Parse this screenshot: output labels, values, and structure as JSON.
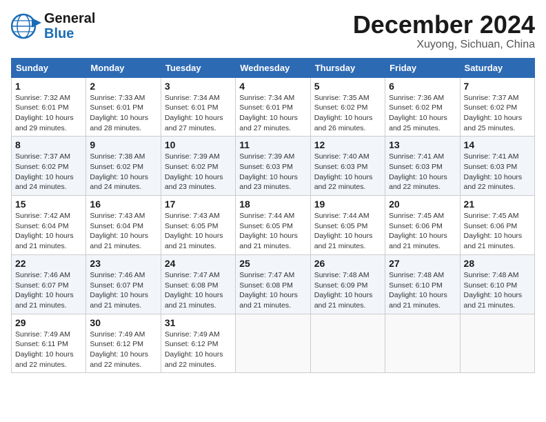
{
  "header": {
    "logo_line1": "General",
    "logo_line2": "Blue",
    "month": "December 2024",
    "location": "Xuyong, Sichuan, China"
  },
  "weekdays": [
    "Sunday",
    "Monday",
    "Tuesday",
    "Wednesday",
    "Thursday",
    "Friday",
    "Saturday"
  ],
  "weeks": [
    [
      {
        "day": "1",
        "sunrise": "7:32 AM",
        "sunset": "6:01 PM",
        "daylight": "10 hours and 29 minutes."
      },
      {
        "day": "2",
        "sunrise": "7:33 AM",
        "sunset": "6:01 PM",
        "daylight": "10 hours and 28 minutes."
      },
      {
        "day": "3",
        "sunrise": "7:34 AM",
        "sunset": "6:01 PM",
        "daylight": "10 hours and 27 minutes."
      },
      {
        "day": "4",
        "sunrise": "7:34 AM",
        "sunset": "6:01 PM",
        "daylight": "10 hours and 27 minutes."
      },
      {
        "day": "5",
        "sunrise": "7:35 AM",
        "sunset": "6:02 PM",
        "daylight": "10 hours and 26 minutes."
      },
      {
        "day": "6",
        "sunrise": "7:36 AM",
        "sunset": "6:02 PM",
        "daylight": "10 hours and 25 minutes."
      },
      {
        "day": "7",
        "sunrise": "7:37 AM",
        "sunset": "6:02 PM",
        "daylight": "10 hours and 25 minutes."
      }
    ],
    [
      {
        "day": "8",
        "sunrise": "7:37 AM",
        "sunset": "6:02 PM",
        "daylight": "10 hours and 24 minutes."
      },
      {
        "day": "9",
        "sunrise": "7:38 AM",
        "sunset": "6:02 PM",
        "daylight": "10 hours and 24 minutes."
      },
      {
        "day": "10",
        "sunrise": "7:39 AM",
        "sunset": "6:02 PM",
        "daylight": "10 hours and 23 minutes."
      },
      {
        "day": "11",
        "sunrise": "7:39 AM",
        "sunset": "6:03 PM",
        "daylight": "10 hours and 23 minutes."
      },
      {
        "day": "12",
        "sunrise": "7:40 AM",
        "sunset": "6:03 PM",
        "daylight": "10 hours and 22 minutes."
      },
      {
        "day": "13",
        "sunrise": "7:41 AM",
        "sunset": "6:03 PM",
        "daylight": "10 hours and 22 minutes."
      },
      {
        "day": "14",
        "sunrise": "7:41 AM",
        "sunset": "6:03 PM",
        "daylight": "10 hours and 22 minutes."
      }
    ],
    [
      {
        "day": "15",
        "sunrise": "7:42 AM",
        "sunset": "6:04 PM",
        "daylight": "10 hours and 21 minutes."
      },
      {
        "day": "16",
        "sunrise": "7:43 AM",
        "sunset": "6:04 PM",
        "daylight": "10 hours and 21 minutes."
      },
      {
        "day": "17",
        "sunrise": "7:43 AM",
        "sunset": "6:05 PM",
        "daylight": "10 hours and 21 minutes."
      },
      {
        "day": "18",
        "sunrise": "7:44 AM",
        "sunset": "6:05 PM",
        "daylight": "10 hours and 21 minutes."
      },
      {
        "day": "19",
        "sunrise": "7:44 AM",
        "sunset": "6:05 PM",
        "daylight": "10 hours and 21 minutes."
      },
      {
        "day": "20",
        "sunrise": "7:45 AM",
        "sunset": "6:06 PM",
        "daylight": "10 hours and 21 minutes."
      },
      {
        "day": "21",
        "sunrise": "7:45 AM",
        "sunset": "6:06 PM",
        "daylight": "10 hours and 21 minutes."
      }
    ],
    [
      {
        "day": "22",
        "sunrise": "7:46 AM",
        "sunset": "6:07 PM",
        "daylight": "10 hours and 21 minutes."
      },
      {
        "day": "23",
        "sunrise": "7:46 AM",
        "sunset": "6:07 PM",
        "daylight": "10 hours and 21 minutes."
      },
      {
        "day": "24",
        "sunrise": "7:47 AM",
        "sunset": "6:08 PM",
        "daylight": "10 hours and 21 minutes."
      },
      {
        "day": "25",
        "sunrise": "7:47 AM",
        "sunset": "6:08 PM",
        "daylight": "10 hours and 21 minutes."
      },
      {
        "day": "26",
        "sunrise": "7:48 AM",
        "sunset": "6:09 PM",
        "daylight": "10 hours and 21 minutes."
      },
      {
        "day": "27",
        "sunrise": "7:48 AM",
        "sunset": "6:10 PM",
        "daylight": "10 hours and 21 minutes."
      },
      {
        "day": "28",
        "sunrise": "7:48 AM",
        "sunset": "6:10 PM",
        "daylight": "10 hours and 21 minutes."
      }
    ],
    [
      {
        "day": "29",
        "sunrise": "7:49 AM",
        "sunset": "6:11 PM",
        "daylight": "10 hours and 22 minutes."
      },
      {
        "day": "30",
        "sunrise": "7:49 AM",
        "sunset": "6:12 PM",
        "daylight": "10 hours and 22 minutes."
      },
      {
        "day": "31",
        "sunrise": "7:49 AM",
        "sunset": "6:12 PM",
        "daylight": "10 hours and 22 minutes."
      },
      null,
      null,
      null,
      null
    ]
  ]
}
